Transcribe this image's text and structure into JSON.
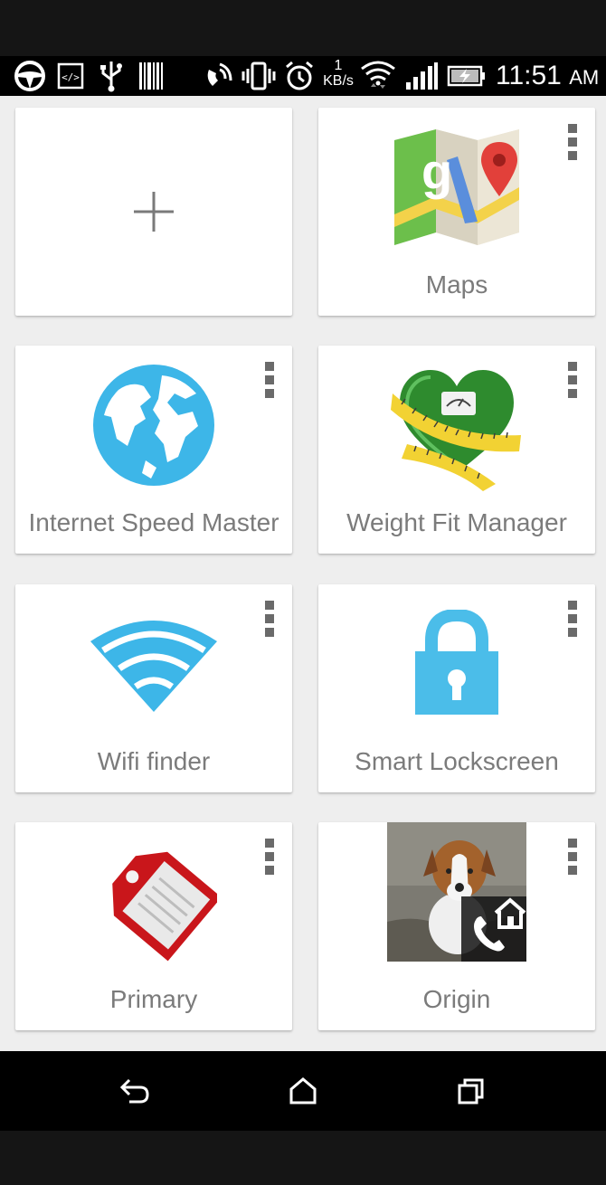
{
  "status_bar": {
    "icons": [
      "steering-wheel-icon",
      "code-icon",
      "usb-icon",
      "barcode-icon",
      "nfc-icon",
      "vibrate-icon",
      "alarm-icon",
      "wifi-icon",
      "data-arrows-icon",
      "signal-icon",
      "battery-charging-icon"
    ],
    "speed_value": "1",
    "speed_unit": "KB/s",
    "time": "11:51",
    "ampm": "AM"
  },
  "cards": [
    {
      "id": "add",
      "label": "",
      "icon": "plus-icon",
      "has_menu": false
    },
    {
      "id": "maps",
      "label": "Maps",
      "icon": "maps-icon",
      "has_menu": true
    },
    {
      "id": "internet-speed-master",
      "label": "Internet Speed Master",
      "icon": "globe-icon",
      "has_menu": true
    },
    {
      "id": "weight-fit-manager",
      "label": "Weight Fit Manager",
      "icon": "heart-scale-icon",
      "has_menu": true
    },
    {
      "id": "wifi-finder",
      "label": "Wifi finder",
      "icon": "wifi-icon",
      "has_menu": true
    },
    {
      "id": "smart-lockscreen",
      "label": "Smart Lockscreen",
      "icon": "lock-icon",
      "has_menu": true
    },
    {
      "id": "primary",
      "label": "Primary",
      "icon": "tag-icon",
      "has_menu": true
    },
    {
      "id": "origin",
      "label": "Origin",
      "icon": "puppy-contact-photo",
      "has_menu": true
    }
  ],
  "colors": {
    "accent_blue": "#3db6e8",
    "background": "#eeeeee",
    "label": "#7b7b7b"
  },
  "nav_bar": {
    "buttons": [
      "back-icon",
      "home-icon",
      "recent-apps-icon"
    ]
  }
}
